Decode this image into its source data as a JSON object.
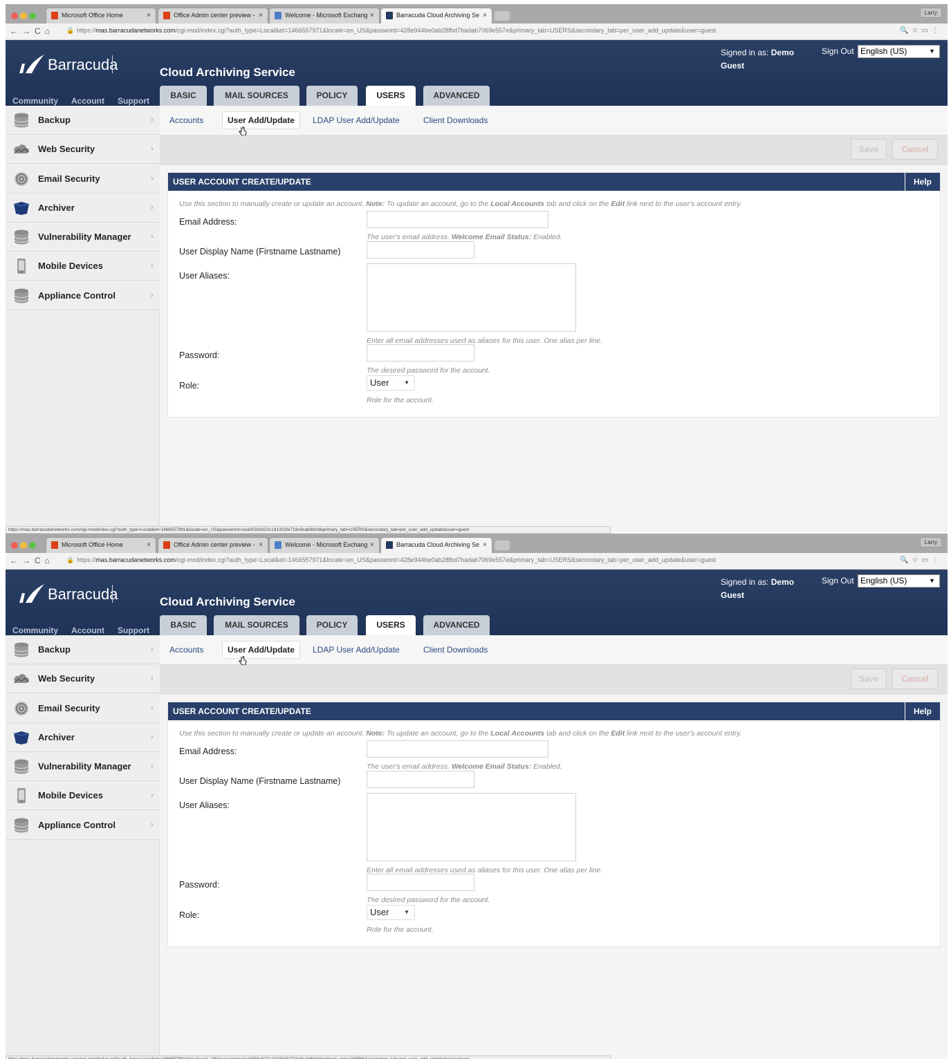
{
  "browser": {
    "tabs": [
      {
        "title": "Microsoft Office Home",
        "close": "×"
      },
      {
        "title": "Office Admin center preview -",
        "close": "×"
      },
      {
        "title": "Welcome - Microsoft Exchang",
        "close": "×"
      },
      {
        "title": "Barracuda Cloud Archiving Se",
        "close": "×"
      }
    ],
    "profile": "Larry",
    "url_scheme": "https://",
    "url_domain": "mas.barracudanetworks.com",
    "url_path": "/cgi-mod/index.cgi?auth_type=Local&et=1466557971&locale=en_US&password=428e944be0ab28fbd7badab7069e557e&primary_tab=USERS&secondary_tab=per_user_add_update&user=guest",
    "status_url": "https://mas.barracudanetworks.com/cgi-mod/index.cgi?auth_type=Local&et=1466557991&locale=en_US&password=1ea0033c622c1d1301fe719c6eab9b0d&primary_tab=USERS&secondary_tab=per_user_add_update&user=guest"
  },
  "header": {
    "logo_text": "Barracuda",
    "service_title": "Cloud Archiving Service",
    "signed_in_label": "Signed in as:",
    "signed_in_user_first": "Demo",
    "signed_in_user_second": "Guest",
    "sign_out": "Sign Out",
    "language": "English (US)",
    "top_links": [
      "Community",
      "Account",
      "Support"
    ],
    "main_tabs": [
      "BASIC",
      "MAIL SOURCES",
      "POLICY",
      "USERS",
      "ADVANCED"
    ],
    "active_tab": "USERS"
  },
  "sidebar": {
    "items": [
      {
        "label": "Backup",
        "icon": "database-icon"
      },
      {
        "label": "Web Security",
        "icon": "cloud-icon"
      },
      {
        "label": "Email Security",
        "icon": "at-sign-icon"
      },
      {
        "label": "Archiver",
        "icon": "archive-icon"
      },
      {
        "label": "Vulnerability Manager",
        "icon": "database-icon"
      },
      {
        "label": "Mobile Devices",
        "icon": "mobile-device-icon"
      },
      {
        "label": "Appliance Control",
        "icon": "database-icon"
      }
    ]
  },
  "subnav": {
    "items": [
      "Accounts",
      "User Add/Update",
      "LDAP User Add/Update",
      "Client Downloads"
    ],
    "active": "User Add/Update"
  },
  "actions": {
    "save": "Save",
    "cancel": "Cancel"
  },
  "panel": {
    "title": "USER ACCOUNT CREATE/UPDATE",
    "help": "Help",
    "note_1": "Use this section to manually create or update an account.",
    "note_2": "Note:",
    "note_3": "To update an account, go to the",
    "note_4": "Local Accounts",
    "note_5": "tab and click on the",
    "note_6": "Edit",
    "note_7": "link next to the user's account entry.",
    "fields": {
      "email_label": "Email Address:",
      "email_value": "",
      "email_hint_1": "The user's email address.",
      "email_hint_2": "Welcome Email Status:",
      "email_hint_3": "Enabled.",
      "display_name_label": "User Display Name (Firstname Lastname)",
      "display_name_value": "",
      "aliases_label": "User Aliases:",
      "aliases_value": "",
      "aliases_hint": "Enter all email addresses used as aliases for this user. One alias per line.",
      "password_label": "Password:",
      "password_value": "",
      "password_hint": "The desired password for the account.",
      "role_label": "Role:",
      "role_value": "User",
      "role_hint": "Role for the account."
    }
  },
  "colors": {
    "header_bg": "#24395f",
    "accent_link": "#2a4a80",
    "sidebar_bg": "#ededed"
  }
}
